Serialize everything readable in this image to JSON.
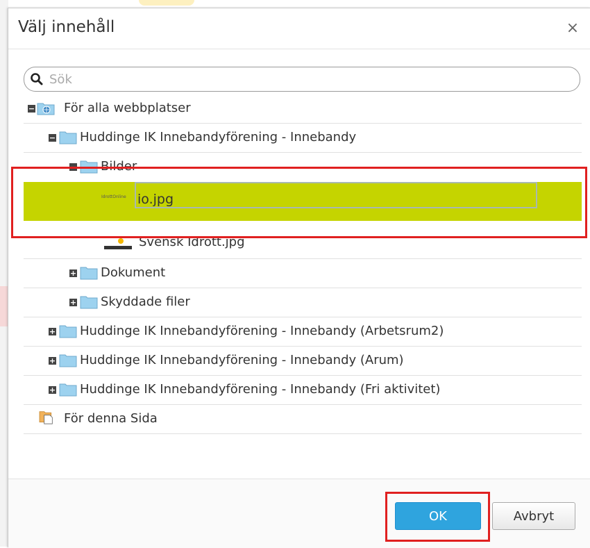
{
  "dialog": {
    "title": "Välj innehåll",
    "close_label": "×"
  },
  "search": {
    "placeholder": "Sök",
    "value": ""
  },
  "tree": {
    "root_label": "För alla webbplatser",
    "site_label": "Huddinge IK Innebandyförening - Innebandy",
    "bilder_label": "Bilder",
    "file_selected_thumb": "IdrottOnline",
    "file_selected_value": "io.jpg",
    "file_svensk_label": "Svensk Idrott.jpg",
    "dokument_label": "Dokument",
    "skyddade_label": "Skyddade filer",
    "site_arbetsrum_label": "Huddinge IK Innebandyförening - Innebandy (Arbetsrum2)",
    "site_arum_label": "Huddinge IK Innebandyförening - Innebandy (Arum)",
    "site_fri_label": "Huddinge IK Innebandyförening - Innebandy (Fri aktivitet)",
    "page_label": "För denna Sida",
    "expand_symbol": "+",
    "collapse_symbol": "−"
  },
  "footer": {
    "ok_label": "OK",
    "cancel_label": "Avbryt"
  },
  "colors": {
    "selected_row": "#c5d400",
    "ok_button": "#2fa4de",
    "highlight": "#e02020"
  }
}
